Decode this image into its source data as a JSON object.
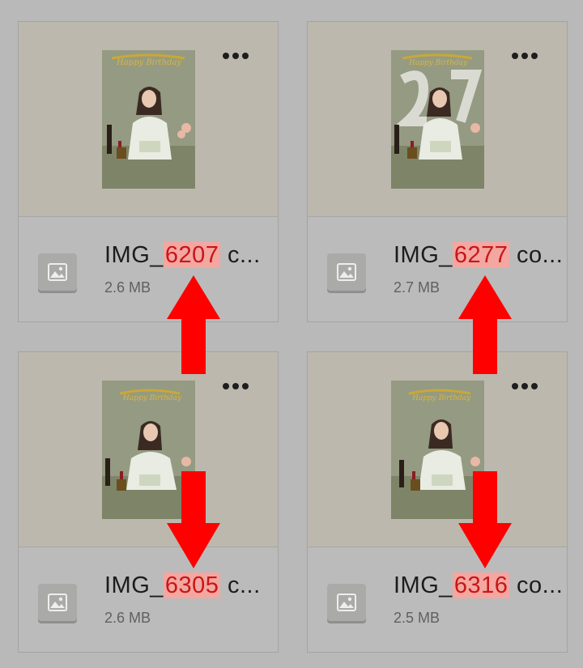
{
  "files": [
    {
      "prefix": "IMG_",
      "number": "6207",
      "suffix": " c...",
      "size": "2.6 MB",
      "variant": "banner-only"
    },
    {
      "prefix": "IMG_",
      "number": "6277",
      "suffix": " co...",
      "size": "2.7 MB",
      "variant": "balloons"
    },
    {
      "prefix": "IMG_",
      "number": "6305",
      "suffix": " c...",
      "size": "2.6 MB",
      "variant": "banner-only"
    },
    {
      "prefix": "IMG_",
      "number": "6316",
      "suffix": " co...",
      "size": "2.5 MB",
      "variant": "banner-only"
    }
  ],
  "colors": {
    "highlight_bg": "#f4a6a1",
    "highlight_text": "#c61717",
    "arrow": "#ff0000",
    "thumb_bg": "#bdb8ad"
  },
  "icons": {
    "more": "more-horizontal-icon",
    "file_type": "image-file-icon",
    "annotation": "red-arrow"
  }
}
